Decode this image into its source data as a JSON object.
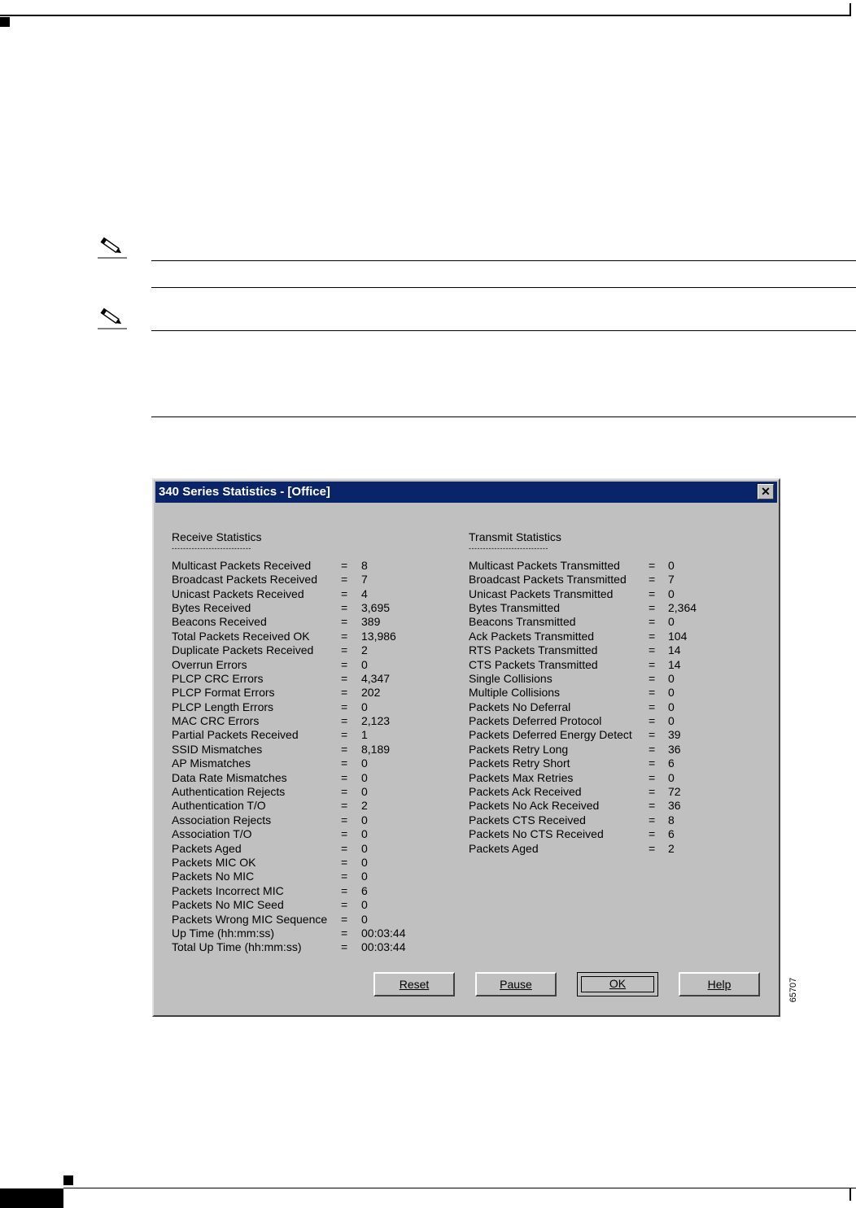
{
  "figure_id": "65707",
  "dialog": {
    "title": "340 Series Statistics - [Office]",
    "close_glyph": "✕",
    "receive": {
      "title": "Receive Statistics",
      "dashes": "----------------------------",
      "rows": [
        {
          "label": "Multicast Packets Received",
          "value": "8"
        },
        {
          "label": "Broadcast Packets Received",
          "value": "7"
        },
        {
          "label": "Unicast Packets Received",
          "value": "4"
        },
        {
          "label": "Bytes Received",
          "value": "3,695"
        },
        {
          "label": "Beacons Received",
          "value": "389"
        },
        {
          "label": "Total Packets Received OK",
          "value": "13,986"
        },
        {
          "label": "Duplicate Packets Received",
          "value": "2"
        },
        {
          "label": "Overrun Errors",
          "value": "0"
        },
        {
          "label": "PLCP CRC Errors",
          "value": "4,347"
        },
        {
          "label": "PLCP Format Errors",
          "value": "202"
        },
        {
          "label": "PLCP Length Errors",
          "value": "0"
        },
        {
          "label": "MAC CRC Errors",
          "value": "2,123"
        },
        {
          "label": "Partial Packets Received",
          "value": "1"
        },
        {
          "label": "SSID Mismatches",
          "value": "8,189"
        },
        {
          "label": "AP Mismatches",
          "value": "0"
        },
        {
          "label": "Data Rate Mismatches",
          "value": "0"
        },
        {
          "label": "Authentication Rejects",
          "value": "0"
        },
        {
          "label": "Authentication T/O",
          "value": "2"
        },
        {
          "label": "Association Rejects",
          "value": "0"
        },
        {
          "label": "Association T/O",
          "value": "0"
        },
        {
          "label": "Packets Aged",
          "value": "0"
        },
        {
          "label": "Packets MIC OK",
          "value": "0"
        },
        {
          "label": "Packets No MIC",
          "value": "0"
        },
        {
          "label": "Packets Incorrect MIC",
          "value": "6"
        },
        {
          "label": "Packets No MIC Seed",
          "value": "0"
        },
        {
          "label": "Packets Wrong MIC Sequence",
          "value": "0"
        },
        {
          "label": "Up Time (hh:mm:ss)",
          "value": "00:03:44"
        },
        {
          "label": "Total Up Time (hh:mm:ss)",
          "value": "00:03:44"
        }
      ]
    },
    "transmit": {
      "title": "Transmit Statistics",
      "dashes": "----------------------------",
      "rows": [
        {
          "label": "Multicast Packets Transmitted",
          "value": "0"
        },
        {
          "label": "Broadcast Packets Transmitted",
          "value": "7"
        },
        {
          "label": "Unicast Packets Transmitted",
          "value": "0"
        },
        {
          "label": "Bytes Transmitted",
          "value": "2,364"
        },
        {
          "label": "Beacons Transmitted",
          "value": "0"
        },
        {
          "label": "Ack Packets Transmitted",
          "value": "104"
        },
        {
          "label": "RTS Packets Transmitted",
          "value": "14"
        },
        {
          "label": "CTS Packets Transmitted",
          "value": "14"
        },
        {
          "label": "Single Collisions",
          "value": "0"
        },
        {
          "label": "Multiple Collisions",
          "value": "0"
        },
        {
          "label": "Packets No Deferral",
          "value": "0"
        },
        {
          "label": "Packets Deferred Protocol",
          "value": "0"
        },
        {
          "label": "Packets Deferred Energy Detect",
          "value": "39"
        },
        {
          "label": "Packets Retry Long",
          "value": "36"
        },
        {
          "label": "Packets Retry Short",
          "value": "6"
        },
        {
          "label": "Packets Max Retries",
          "value": "0"
        },
        {
          "label": "Packets Ack Received",
          "value": "72"
        },
        {
          "label": "Packets No Ack Received",
          "value": "36"
        },
        {
          "label": "Packets CTS Received",
          "value": "8"
        },
        {
          "label": "Packets No CTS Received",
          "value": "6"
        },
        {
          "label": "Packets Aged",
          "value": "2"
        }
      ]
    },
    "equals": "=",
    "buttons": {
      "reset": "Reset",
      "pause": "Pause",
      "ok": "OK",
      "help": "Help"
    }
  }
}
